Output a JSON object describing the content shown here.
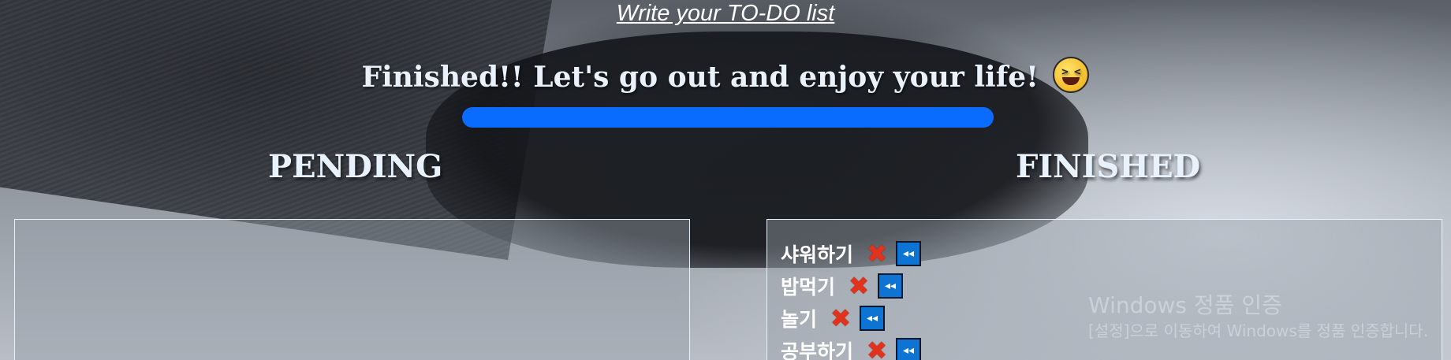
{
  "header": {
    "title": "Write your TO-DO list",
    "message": "Finished!! Let's go out and enjoy your life!",
    "emoji_icon": "laughing-face-icon"
  },
  "progress": {
    "fraction": 1.0,
    "color": "#0a6cff"
  },
  "pending": {
    "title": "PENDING",
    "tasks": []
  },
  "finished": {
    "title": "FINISHED",
    "tasks": [
      {
        "label": "샤워하기",
        "delete_icon": "✖",
        "back_icon": "◂◂"
      },
      {
        "label": "밥먹기",
        "delete_icon": "✖",
        "back_icon": "◂◂"
      },
      {
        "label": "놀기",
        "delete_icon": "✖",
        "back_icon": "◂◂"
      },
      {
        "label": "공부하기",
        "delete_icon": "✖",
        "back_icon": "◂◂"
      }
    ]
  },
  "watermark": {
    "title": "Windows 정품 인증",
    "subtitle": "[설정]으로 이동하여 Windows를 정품 인증합니다."
  }
}
